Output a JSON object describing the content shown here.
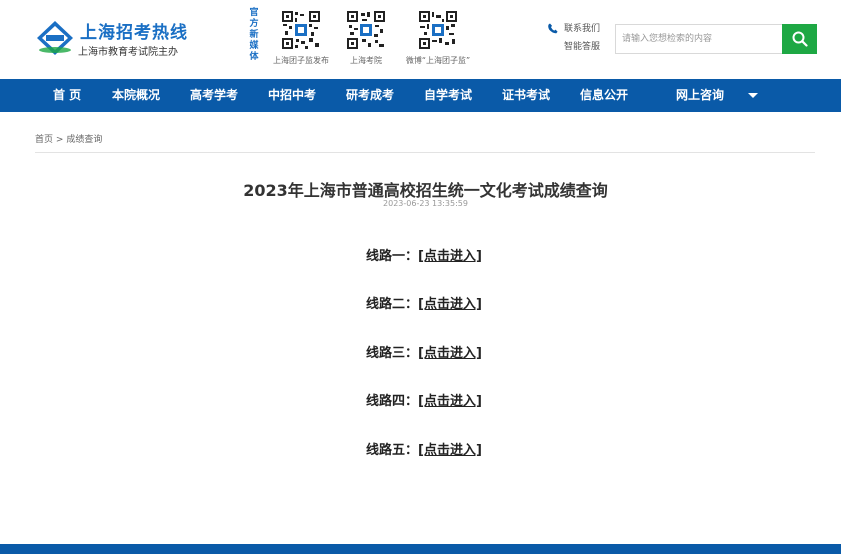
{
  "header": {
    "logo_title": "上海招考热线",
    "logo_subtitle": "上海市教育考试院主办",
    "media_label": "官方新媒体",
    "qr_codes": [
      {
        "caption": "上海团子监发布"
      },
      {
        "caption": "上海考院"
      },
      {
        "caption": "微博“上海团子监”"
      }
    ],
    "contact": {
      "contact_us": "联系我们",
      "smart_answer": "智能答服"
    },
    "search": {
      "placeholder": "请输入您想检索的内容"
    }
  },
  "nav": {
    "items": [
      "首 页",
      "本院概况",
      "高考学考",
      "中招中考",
      "研考成考",
      "自学考试",
      "证书考试",
      "信息公开",
      "网上咨询"
    ]
  },
  "breadcrumb": {
    "home": "首页",
    "separator": ">",
    "current": "成绩查询"
  },
  "article": {
    "title": "2023年上海市普通高校招生统一文化考试成绩查询",
    "date": "2023-06-23 13:35:59",
    "lines": [
      {
        "label": "线路一：",
        "link": "[点击进入]"
      },
      {
        "label": "线路二：",
        "link": "[点击进入]"
      },
      {
        "label": "线路三：",
        "link": "[点击进入]"
      },
      {
        "label": "线路四：",
        "link": "[点击进入]"
      },
      {
        "label": "线路五：",
        "link": "[点击进入]"
      }
    ]
  },
  "colors": {
    "brand_blue": "#0a5aa8",
    "logo_blue": "#1a6fc4",
    "search_green": "#1ea844"
  }
}
